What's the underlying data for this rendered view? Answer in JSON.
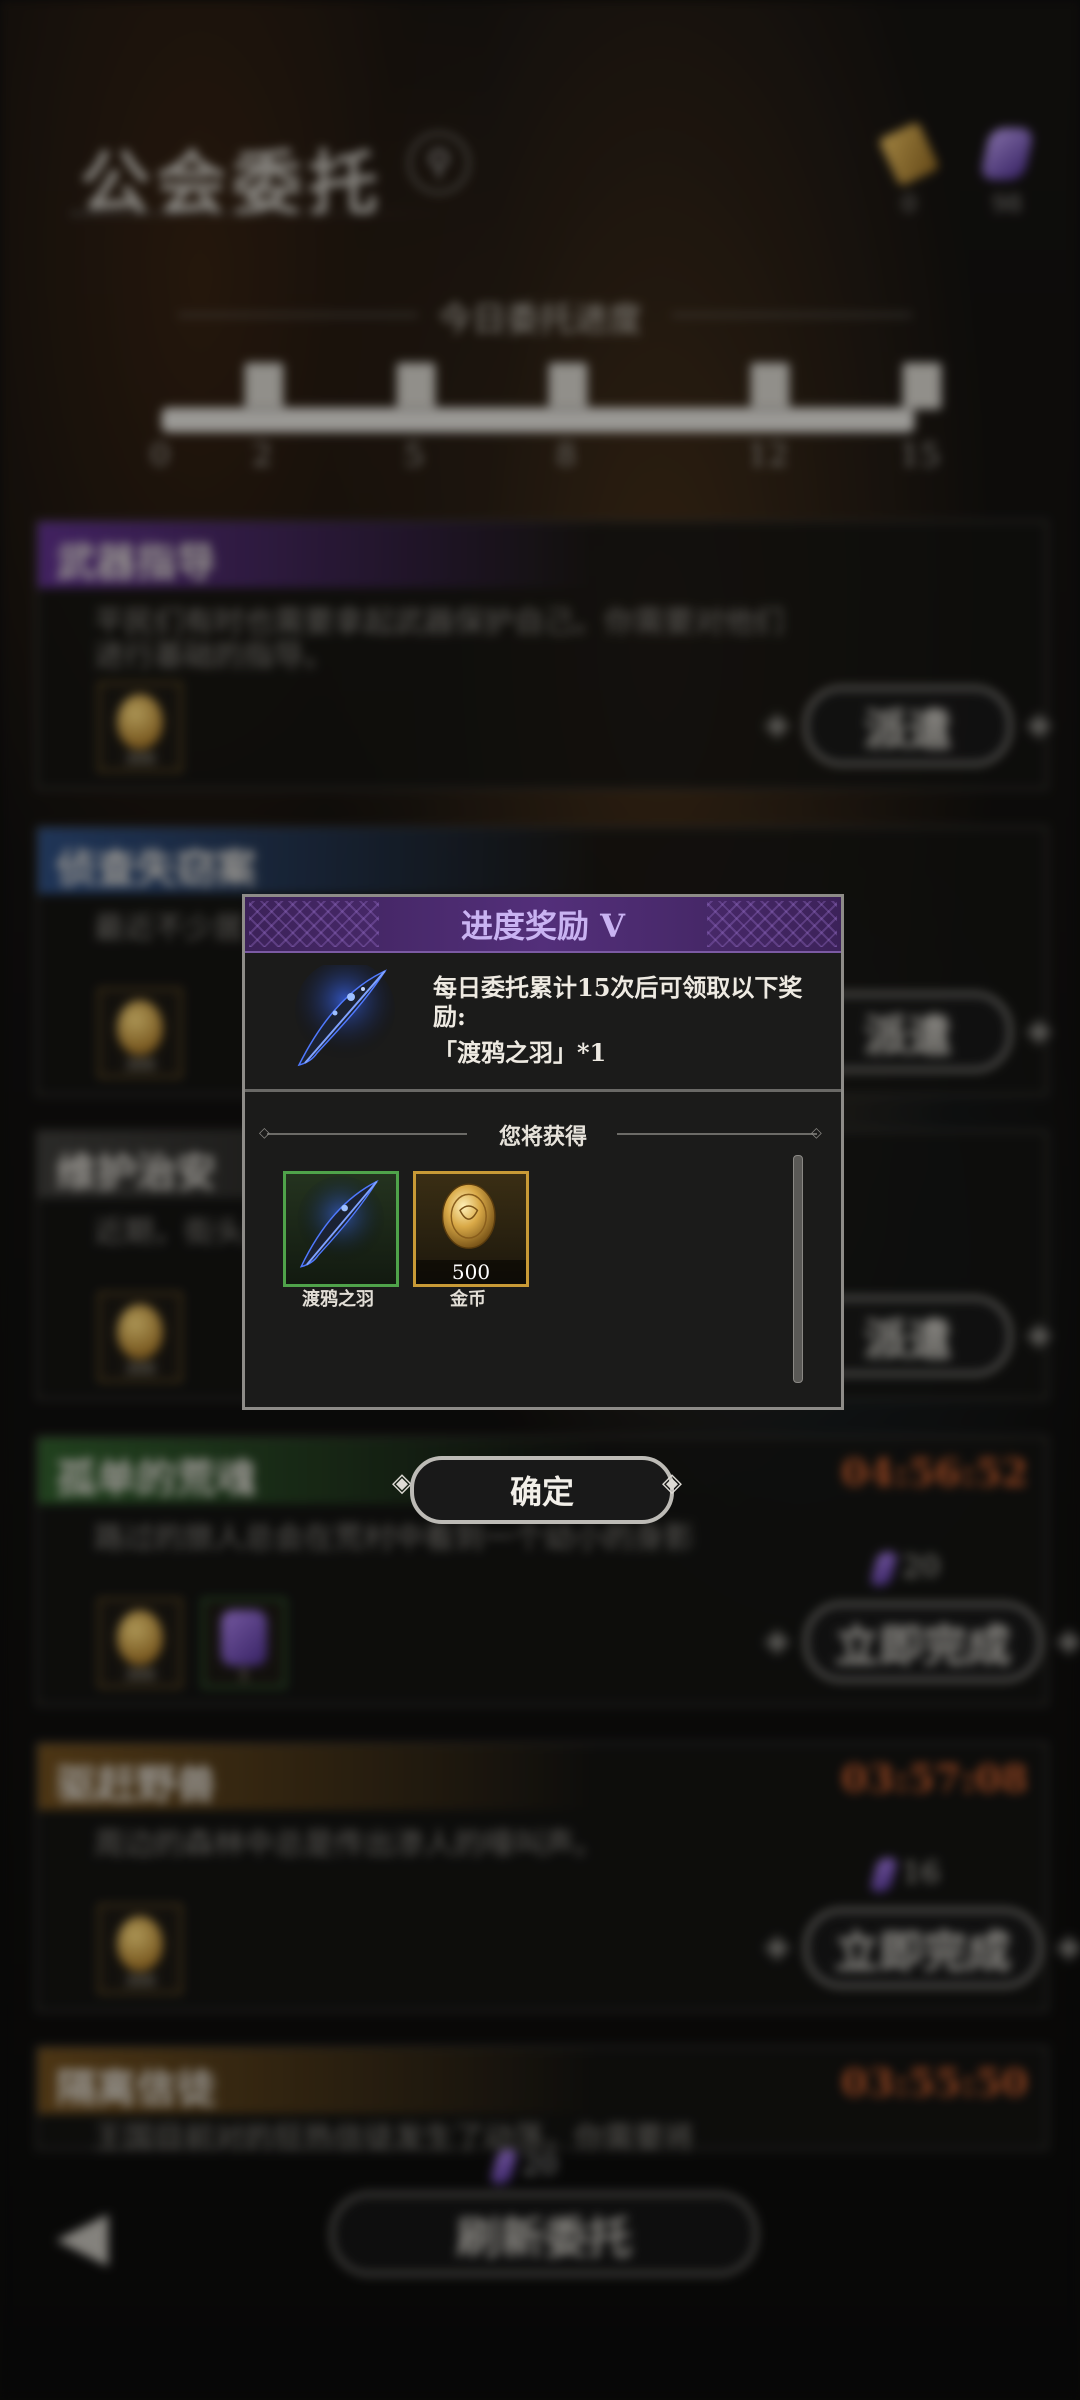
{
  "header": {
    "title": "公会委托",
    "currencies": [
      {
        "icon": "scroll-ticket-icon",
        "value": "0"
      },
      {
        "icon": "purple-crystal-icon",
        "value": "98"
      }
    ]
  },
  "progress": {
    "title": "今日委托进度",
    "ticks": [
      "0",
      "2",
      "5",
      "8",
      "12",
      "15"
    ],
    "fill_fraction": 1.0
  },
  "quests": [
    {
      "title": "武器指导",
      "desc": "平民们有时也需要拿起武器保护自己。你需要对他们进行基础的指导。",
      "rewards": [
        "300"
      ],
      "action": "派遣",
      "timer": "",
      "cost": "",
      "accent": "#5b2f86"
    },
    {
      "title": "侦查失窃案",
      "desc": "最近不少居",
      "rewards": [
        "300"
      ],
      "action": "派遣",
      "timer": "",
      "cost": "",
      "accent": "#2c4a7a"
    },
    {
      "title": "维护治安",
      "desc": "近期，街头发生在的",
      "rewards": [
        "300"
      ],
      "action": "派遣",
      "timer": "",
      "cost": "",
      "accent": "#3b3a37"
    },
    {
      "title": "孤单的荒魂",
      "desc": "路过的旅人总会在荒村中看到一个幼小的身影",
      "rewards": [
        "300",
        "1"
      ],
      "action": "立即完成",
      "timer": "04:56:52",
      "cost": "20",
      "accent": "#2e5a2a"
    },
    {
      "title": "驱赶野兽",
      "desc": "周边的森林中总是传出渗人的嚎叫声。",
      "rewards": [
        "300"
      ],
      "action": "立即完成",
      "timer": "03:57:08",
      "cost": "16",
      "accent": "#6a4a1c"
    },
    {
      "title": "隔离信徒",
      "desc": "王国目前对的狂热信徒发生了动荡，你需要将",
      "rewards": [],
      "action": "",
      "timer": "03:55:50",
      "cost": "",
      "accent": "#6a4a1c"
    }
  ],
  "bottom": {
    "refresh_label": "刷新委托",
    "refresh_cost": "20"
  },
  "modal": {
    "title": "进度奖励 V",
    "description": "每日委托累计15次后可领取以下奖励:",
    "item_line": "「渡鸦之羽」*1",
    "obtain_label": "您将获得",
    "rewards": [
      {
        "name": "渡鸦之羽",
        "amount": "",
        "icon": "raven-feather-icon"
      },
      {
        "name": "金币",
        "amount": "500",
        "icon": "gold-coin-icon"
      }
    ],
    "confirm_label": "确定"
  },
  "colors": {
    "modal_header": "#532f7a",
    "timer": "#c15a2c",
    "rare_border": "#4fa34a",
    "gold_border": "#c89a36"
  }
}
